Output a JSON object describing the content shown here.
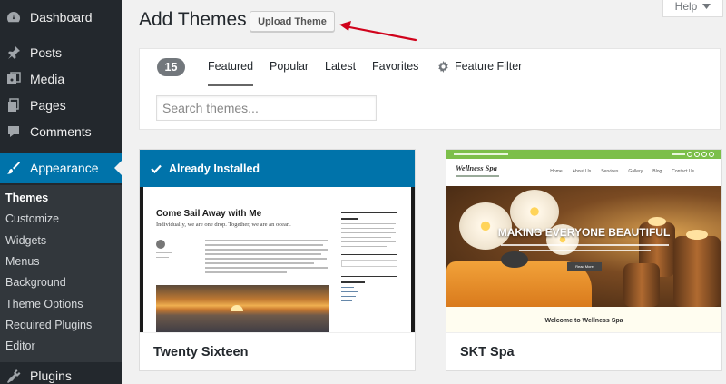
{
  "sidebar": {
    "items": [
      {
        "label": "Dashboard",
        "icon": "dashboard-icon"
      },
      {
        "label": "Posts",
        "icon": "pin-icon"
      },
      {
        "label": "Media",
        "icon": "media-icon"
      },
      {
        "label": "Pages",
        "icon": "pages-icon"
      },
      {
        "label": "Comments",
        "icon": "comment-icon"
      },
      {
        "label": "Appearance",
        "icon": "brush-icon",
        "active": true
      },
      {
        "label": "Plugins",
        "icon": "plugin-icon"
      }
    ],
    "submenu": [
      {
        "label": "Themes",
        "current": true
      },
      {
        "label": "Customize"
      },
      {
        "label": "Widgets"
      },
      {
        "label": "Menus"
      },
      {
        "label": "Background"
      },
      {
        "label": "Theme Options"
      },
      {
        "label": "Required Plugins"
      },
      {
        "label": "Editor"
      }
    ]
  },
  "header": {
    "title": "Add Themes",
    "upload_label": "Upload Theme",
    "help_label": "Help"
  },
  "filters": {
    "count": "15",
    "tabs": [
      "Featured",
      "Popular",
      "Latest",
      "Favorites"
    ],
    "current_tab": "Featured",
    "feature_filter_label": "Feature Filter",
    "search_placeholder": "Search themes...",
    "search_value": ""
  },
  "themes": [
    {
      "name": "Twenty Sixteen",
      "installed_label": "Already Installed",
      "preview": {
        "post_title": "Come Sail Away with Me",
        "post_subtitle": "Individually, we are one drop. Together, we are an ocean."
      }
    },
    {
      "name": "SKT Spa",
      "preview": {
        "logo": "Wellness Spa",
        "nav": [
          "Home",
          "About Us",
          "Services",
          "Gallery",
          "Blog",
          "Contact Us"
        ],
        "headline": "MAKING EVERYONE BEAUTIFUL",
        "button_label": "Read More",
        "welcome": "Welcome to Wellness Spa"
      }
    }
  ],
  "colors": {
    "sidebar_bg": "#23282d",
    "submenu_bg": "#32373c",
    "accent": "#0073aa",
    "annotation_arrow": "#d0021b",
    "spa_green": "#7cbf4a"
  }
}
